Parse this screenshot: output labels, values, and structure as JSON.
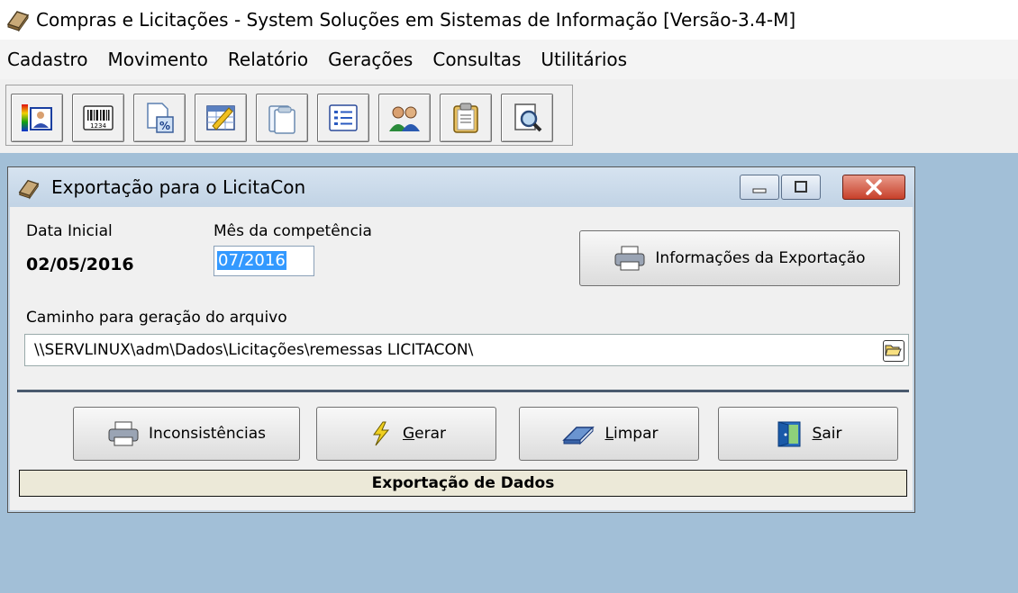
{
  "window": {
    "title": "Compras e Licitações - System Soluções em Sistemas de Informação [Versão-3.4-M]"
  },
  "menu": {
    "items": [
      "Cadastro",
      "Movimento",
      "Relatório",
      "Gerações",
      "Consultas",
      "Utilitários"
    ]
  },
  "toolbar": {
    "buttons": [
      "color-person-icon",
      "barcode-icon",
      "document-percent-icon",
      "spreadsheet-edit-icon",
      "clipboard-stack-icon",
      "list-icon",
      "people-icon",
      "clipboard-icon",
      "search-document-icon"
    ]
  },
  "dialog": {
    "title": "Exportação para o LicitaCon",
    "data_inicial_label": "Data Inicial",
    "data_inicial_value": "02/05/2016",
    "competencia_label": "Mês da competência",
    "competencia_value": "07/2016",
    "info_button": "Informações da Exportação",
    "path_label": "Caminho para geração do arquivo",
    "path_value": "\\\\SERVLINUX\\adm\\Dados\\Licitações\\remessas LICITACON\\",
    "buttons": {
      "inconsistencias": "Inconsistências",
      "gerar_accel": "G",
      "gerar_rest": "erar",
      "limpar_accel": "L",
      "limpar_rest": "impar",
      "sair_accel": "S",
      "sair_rest": "air"
    },
    "status": "Exportação de Dados"
  },
  "colors": {
    "mdi_background": "#a2bfd7",
    "selection": "#3399ff",
    "close_button": "#c7402a"
  }
}
